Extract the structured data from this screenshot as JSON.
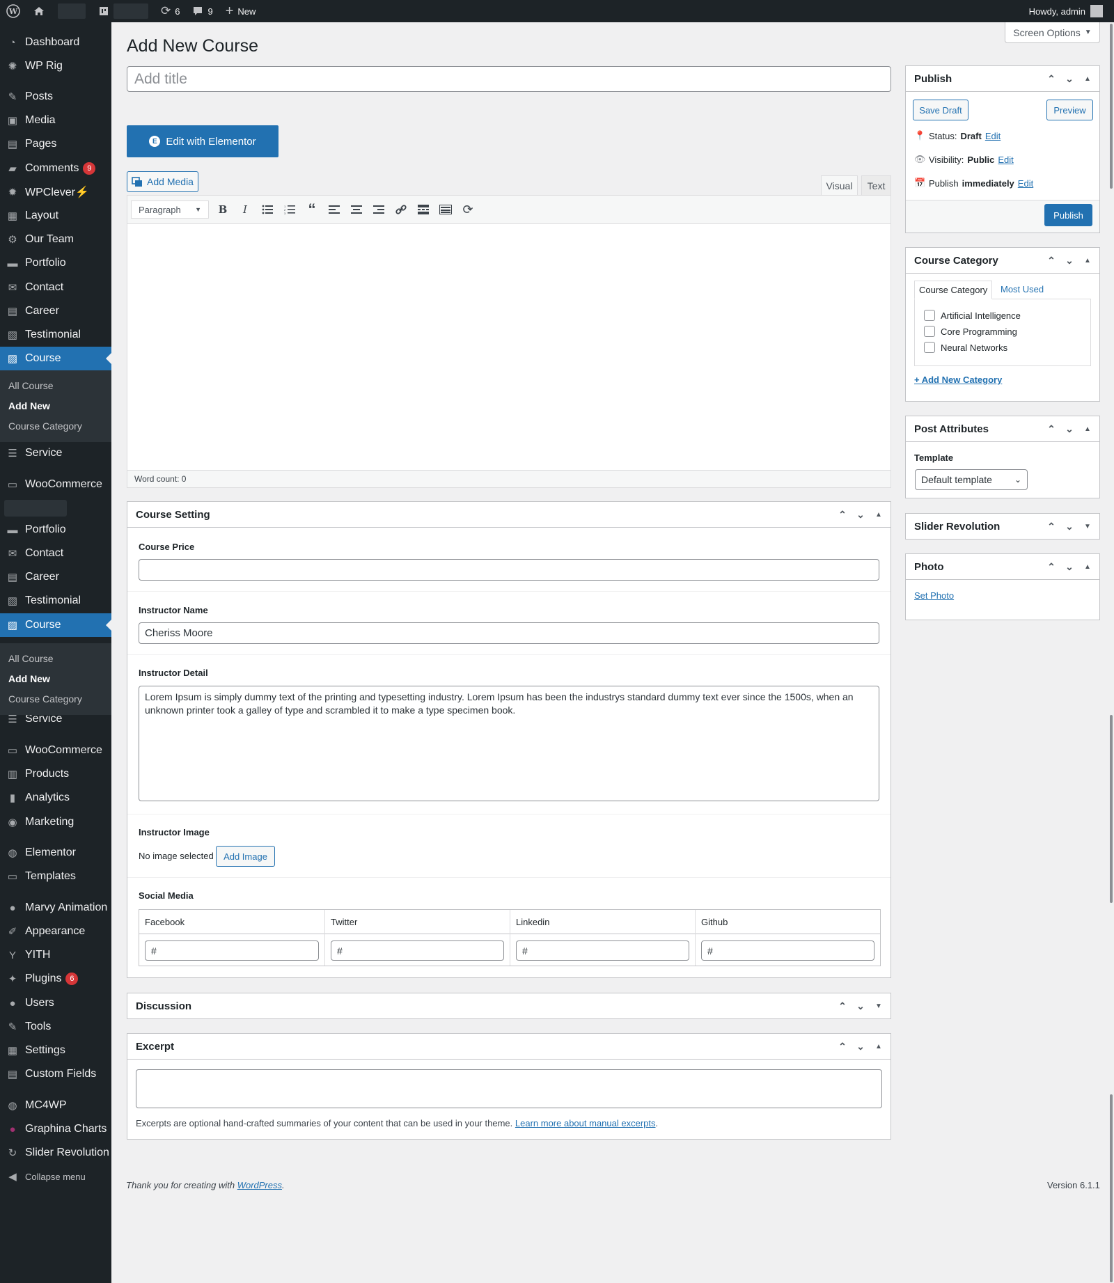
{
  "adminbar": {
    "updates_count": "6",
    "comments_count": "9",
    "new_label": "New",
    "howdy": "Howdy, admin"
  },
  "sidebar": {
    "items": [
      {
        "label": "Dashboard",
        "icon": "dashboard-icon"
      },
      {
        "label": "WP Rig",
        "icon": "wprig-icon"
      },
      {
        "label": "Posts",
        "icon": "pin-icon"
      },
      {
        "label": "Media",
        "icon": "media-icon"
      },
      {
        "label": "Pages",
        "icon": "pages-icon"
      },
      {
        "label": "Comments",
        "icon": "comment-icon",
        "badge": "9"
      },
      {
        "label": "WPClever⚡",
        "icon": "wpclever-icon"
      },
      {
        "label": "Layout",
        "icon": "layout-icon"
      },
      {
        "label": "Our Team",
        "icon": "team-icon"
      },
      {
        "label": "Portfolio",
        "icon": "portfolio-icon"
      },
      {
        "label": "Contact",
        "icon": "email-icon"
      },
      {
        "label": "Career",
        "icon": "career-icon"
      },
      {
        "label": "Testimonial",
        "icon": "testimonial-icon"
      },
      {
        "label": "Course",
        "icon": "course-icon"
      },
      {
        "label": "Service",
        "icon": "service-icon"
      },
      {
        "label": "WooCommerce",
        "icon": "woo-icon"
      },
      {
        "label": "Portfolio",
        "icon": "portfolio-icon"
      },
      {
        "label": "Contact",
        "icon": "email-icon"
      },
      {
        "label": "Career",
        "icon": "career-icon"
      },
      {
        "label": "Testimonial",
        "icon": "testimonial-icon"
      },
      {
        "label": "Course",
        "icon": "course-icon"
      },
      {
        "label": "Service",
        "icon": "service-icon"
      },
      {
        "label": "WooCommerce",
        "icon": "woo-icon"
      },
      {
        "label": "Products",
        "icon": "products-icon"
      },
      {
        "label": "Analytics",
        "icon": "analytics-icon"
      },
      {
        "label": "Marketing",
        "icon": "marketing-icon"
      },
      {
        "label": "Elementor",
        "icon": "elementor-icon"
      },
      {
        "label": "Templates",
        "icon": "templates-icon"
      },
      {
        "label": "Marvy Animation",
        "icon": "marvy-icon"
      },
      {
        "label": "Appearance",
        "icon": "appearance-icon"
      },
      {
        "label": "YITH",
        "icon": "yith-icon"
      },
      {
        "label": "Plugins",
        "icon": "plugins-icon",
        "badge": "6"
      },
      {
        "label": "Users",
        "icon": "users-icon"
      },
      {
        "label": "Tools",
        "icon": "tools-icon"
      },
      {
        "label": "Settings",
        "icon": "settings-icon"
      },
      {
        "label": "Custom Fields",
        "icon": "custom-fields-icon"
      },
      {
        "label": "MC4WP",
        "icon": "mc4wp-icon"
      },
      {
        "label": "Graphina Charts",
        "icon": "graphina-icon"
      },
      {
        "label": "Slider Revolution",
        "icon": "slider-icon"
      },
      {
        "label": "Collapse menu",
        "icon": "collapse-icon"
      }
    ],
    "course_submenu": [
      "All Course",
      "Add New",
      "Course Category"
    ]
  },
  "page": {
    "title": "Add New Course",
    "screen_options": "Screen Options",
    "title_placeholder": "Add title",
    "edit_elementor": "Edit with Elementor",
    "add_media": "Add Media",
    "tab_visual": "Visual",
    "tab_text": "Text",
    "format_select": "Paragraph",
    "word_count": "Word count: 0"
  },
  "course_setting": {
    "title": "Course Setting",
    "price_label": "Course Price",
    "price_value": "",
    "instructor_name_label": "Instructor Name",
    "instructor_name_value": "Cheriss Moore",
    "instructor_detail_label": "Instructor Detail",
    "instructor_detail_value": "Lorem Ipsum is simply dummy text of the printing and typesetting industry. Lorem Ipsum has been the industrys standard dummy text ever since the 1500s, when an unknown printer took a galley of type and scrambled it to make a type specimen book.",
    "instructor_image_label": "Instructor Image",
    "no_image": "No image selected",
    "add_image": "Add Image",
    "social_label": "Social Media",
    "social_columns": [
      "Facebook",
      "Twitter",
      "Linkedin",
      "Github"
    ],
    "social_values": [
      "#",
      "#",
      "#",
      "#"
    ]
  },
  "discussion": {
    "title": "Discussion"
  },
  "excerpt": {
    "title": "Excerpt",
    "help": "Excerpts are optional hand-crafted summaries of your content that can be used in your theme.",
    "link": "Learn more about manual excerpts"
  },
  "footer": {
    "thanks": "Thank you for creating with",
    "wp_link": "WordPress",
    "version": "Version 6.1.1"
  },
  "publish": {
    "title": "Publish",
    "save_draft": "Save Draft",
    "preview": "Preview",
    "status_label": "Status:",
    "status_value": "Draft",
    "visibility_label": "Visibility:",
    "visibility_value": "Public",
    "publish_label": "Publish",
    "publish_value": "immediately",
    "edit": "Edit",
    "publish_button": "Publish"
  },
  "course_category": {
    "title": "Course Category",
    "tab_all": "Course Category",
    "tab_used": "Most Used",
    "items": [
      "Artificial Intelligence",
      "Core Programming",
      "Neural Networks"
    ],
    "add_new": "+ Add New Category"
  },
  "post_attributes": {
    "title": "Post Attributes",
    "template_label": "Template",
    "template_value": "Default template"
  },
  "slider_revolution": {
    "title": "Slider Revolution"
  },
  "photo": {
    "title": "Photo",
    "set_photo": "Set Photo"
  }
}
